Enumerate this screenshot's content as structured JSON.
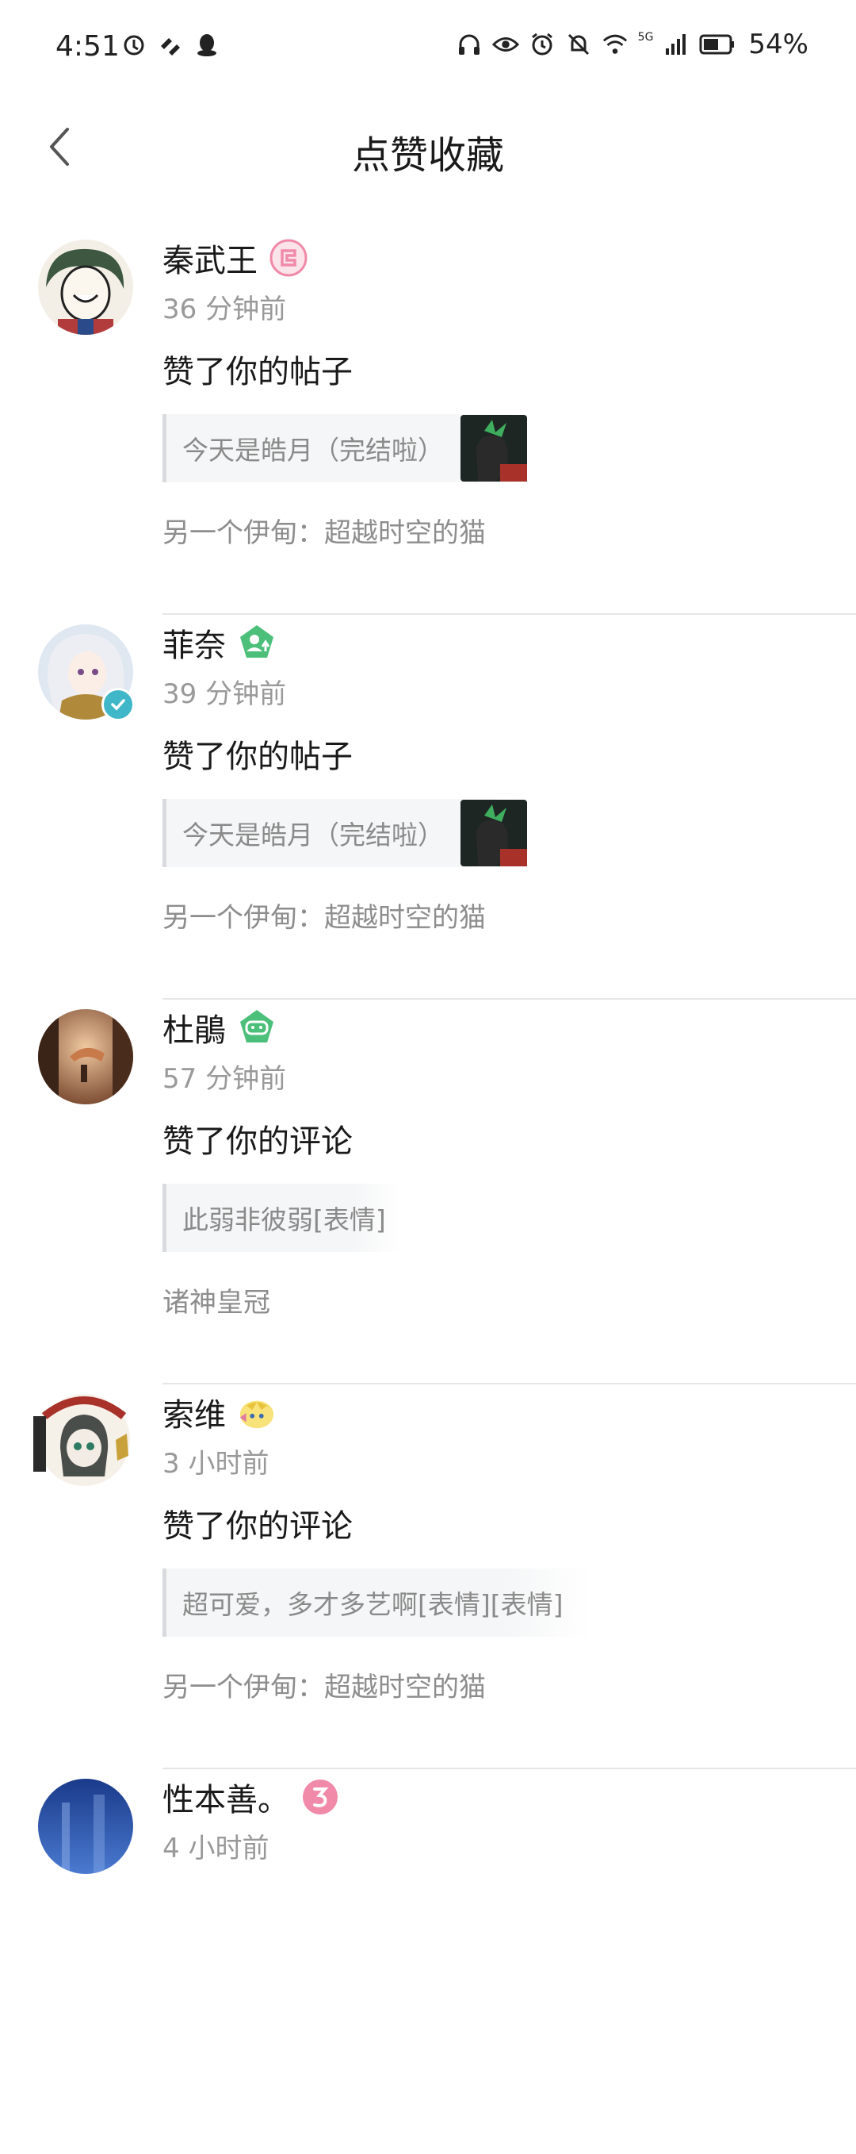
{
  "status_bar": {
    "time": "4:51",
    "battery": "54%",
    "network": "5G",
    "icons": [
      "nfc-icon",
      "vpn-icon",
      "qq-icon",
      "headphones-icon",
      "eye-icon",
      "alarm-icon",
      "mute-icon",
      "wifi-icon",
      "signal-icon",
      "battery-icon"
    ]
  },
  "header": {
    "title": "点赞收藏",
    "back_icon": "chevron-left-icon"
  },
  "items": [
    {
      "name": "秦武王",
      "time": "36 分钟前",
      "action": "赞了你的帖子",
      "quote": "今天是皓月（完结啦）",
      "has_thumb": true,
      "source": "另一个伊甸：超越时空的猫",
      "badge": "level-badge-pink",
      "verified": false
    },
    {
      "name": "菲奈",
      "time": "39 分钟前",
      "action": "赞了你的帖子",
      "quote": "今天是皓月（完结啦）",
      "has_thumb": true,
      "source": "另一个伊甸：超越时空的猫",
      "badge": "level-badge-green-person",
      "verified": true
    },
    {
      "name": "杜鵑",
      "time": "57 分钟前",
      "action": "赞了你的评论",
      "quote": "此弱非彼弱[表情]",
      "has_thumb": false,
      "source": "诸神皇冠",
      "badge": "level-badge-green-gamepad",
      "verified": false
    },
    {
      "name": "索维",
      "time": "3 小时前",
      "action": "赞了你的评论",
      "quote": "超可爱，多才多艺啊[表情][表情]",
      "has_thumb": false,
      "source": "另一个伊甸：超越时空的猫",
      "badge": "decor-badge-character",
      "verified": false
    },
    {
      "name": "性本善。",
      "time": "4 小时前",
      "action": "",
      "quote": "",
      "has_thumb": false,
      "source": "",
      "badge": "level-badge-pink-3",
      "verified": false
    }
  ],
  "colors": {
    "accent_green": "#4cbf7a",
    "accent_pink": "#f08aa8",
    "verified": "#3fb7c9"
  }
}
